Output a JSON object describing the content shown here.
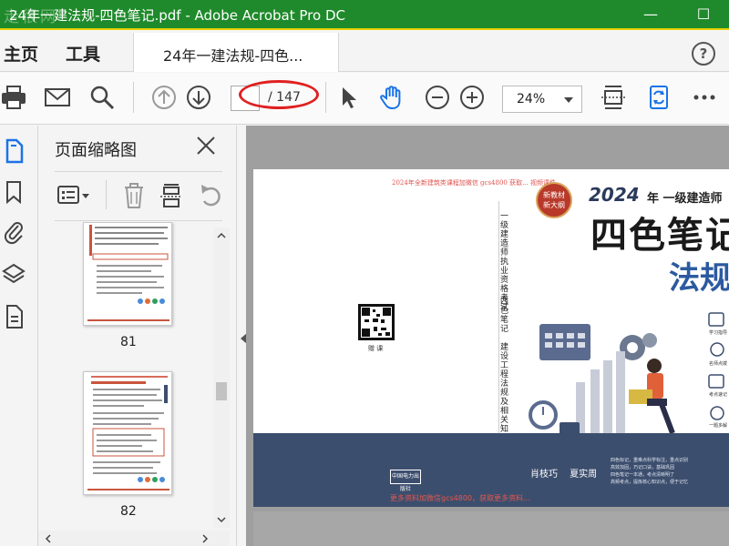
{
  "window": {
    "title": "24年一建法规-四色笔记.pdf - Adobe Acrobat Pro DC",
    "watermark": "走很网",
    "controls": {
      "minimize": "—",
      "restore": "☐"
    }
  },
  "menu": {
    "home": "主页",
    "tools": "工具",
    "help": "?"
  },
  "tab": {
    "label": "24年一建法规-四色..."
  },
  "toolbar": {
    "page_total": "/ 147",
    "page_input_value": "",
    "zoom": "24%",
    "icons": [
      "print-icon",
      "mail-icon",
      "search-icon",
      "prev-page-icon",
      "next-page-icon",
      "pointer-icon",
      "hand-icon",
      "zoom-out-icon",
      "zoom-in-icon",
      "fit-page-icon",
      "rotate-icon",
      "more-icon"
    ]
  },
  "panel": {
    "title": "页面缩略图",
    "thumbnails": [
      {
        "page": "81"
      },
      {
        "page": "82"
      }
    ]
  },
  "cover": {
    "top_line": "2024年全新建筑类课程加微信 gcs4800 获取...  视频课件。",
    "badge_line1": "新教材",
    "badge_line2": "新大纲",
    "year": "2024",
    "year_sub": "年 一级建造师",
    "title": "四色笔记",
    "subject": "法规",
    "spine_col1": "一级建造师执业资格考试",
    "spine_col2": "四色笔记",
    "spine_col3": "建设工程法规及相关知识",
    "qr_label": "赠 课",
    "authors": "肖枝巧 夏实周",
    "features": [
      "四色标记，重难点科学标注，重点识别",
      "高效加固，巧记口诀，基础巩固",
      "四色笔记一本通，考点清晰明了",
      "高频考点，提炼核心知识点，便于记忆"
    ],
    "publisher": "中国电力出版社",
    "bottom_line": "更多资料加微信gcs4800，获取更多资料...",
    "side_icons": [
      "学习指导",
      "名师点拨",
      "考点速记",
      "一题多解"
    ]
  },
  "colors": {
    "titlebar": "#1f8a2b",
    "accent_blue": "#1a73e8",
    "cover_navy": "#3c4e6e",
    "red_annotation": "#e02020",
    "cover_red": "#b8392a"
  }
}
